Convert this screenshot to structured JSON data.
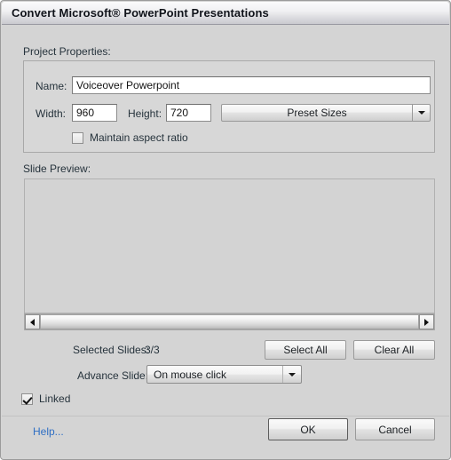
{
  "window": {
    "title": "Convert Microsoft® PowerPoint Presentations"
  },
  "project_properties": {
    "section_label": "Project Properties:",
    "name_label": "Name:",
    "name_value": "Voiceover Powerpoint",
    "name_placeholder": "",
    "width_label": "Width:",
    "width_value": "960",
    "height_label": "Height:",
    "height_value": "720",
    "preset_sizes_label": "Preset Sizes",
    "preset_arrow_icon": "chevron-down-icon",
    "maintain_aspect_label": "Maintain aspect ratio",
    "maintain_aspect_checked": false
  },
  "slide_preview": {
    "section_label": "Slide Preview:",
    "scroll_left_icon": "triangle-left-icon",
    "scroll_right_icon": "triangle-right-icon"
  },
  "selection": {
    "selected_slides_label": "Selected Slides:",
    "selected_slides_value": "3/3",
    "select_all_label": "Select All",
    "clear_all_label": "Clear All"
  },
  "advance": {
    "label": "Advance Slide:",
    "value": "On mouse click",
    "arrow_icon": "chevron-down-icon",
    "options": [
      "On mouse click"
    ]
  },
  "linked": {
    "label": "Linked",
    "checked": true
  },
  "footer": {
    "help_label": "Help...",
    "ok_label": "OK",
    "cancel_label": "Cancel"
  },
  "colors": {
    "dialog_bg": "#d4d4d4",
    "groupbox_bg": "#d7d7d7",
    "preview_bg": "#d3d3d3",
    "link": "#2f6fc4",
    "text": "#26333c",
    "border": "#9b9b9b"
  }
}
